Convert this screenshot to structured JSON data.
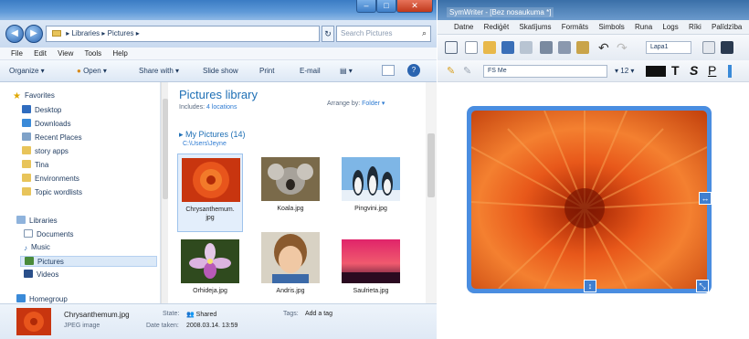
{
  "explorer": {
    "window_buttons": {
      "min": "–",
      "max": "□",
      "close": "✕"
    },
    "address": {
      "path": "▸ Libraries ▸ Pictures ▸",
      "refresh": "↻"
    },
    "search_placeholder": "Search Pictures",
    "menu": [
      "File",
      "Edit",
      "View",
      "Tools",
      "Help"
    ],
    "commands": {
      "organize": "Organize ▾",
      "open": "Open ▾",
      "share": "Share with ▾",
      "slideshow": "Slide show",
      "print": "Print",
      "email": "E-mail",
      "burn": "▾",
      "views": "▾"
    },
    "nav": {
      "favorites": "Favorites",
      "desktop": "Desktop",
      "downloads": "Downloads",
      "recent": "Recent Places",
      "story_apps": "story apps",
      "tina": "Tina",
      "environments": "Environments",
      "topic": "Topic wordlists",
      "libraries": "Libraries",
      "documents": "Documents",
      "music": "Music",
      "pictures": "Pictures",
      "videos": "Videos",
      "homegroup": "Homegroup"
    },
    "library": {
      "title": "Pictures library",
      "includes_label": "Includes:",
      "includes_value": "4 locations",
      "arrange_label": "Arrange by:",
      "arrange_value": "Folder ▾"
    },
    "group": {
      "title": "▸ My Pictures (14)",
      "path": "C:\\Users\\Jeyne"
    },
    "files": [
      {
        "name": "Chrysanthemum.",
        "name2": "jpg"
      },
      {
        "name": "Koala.jpg",
        "name2": ""
      },
      {
        "name": "Pingvini.jpg",
        "name2": ""
      },
      {
        "name": "Orhideja.jpg",
        "name2": ""
      },
      {
        "name": "Andris.jpg",
        "name2": ""
      },
      {
        "name": "Saulrieta.jpg",
        "name2": ""
      }
    ],
    "details": {
      "filename": "Chrysanthemum.jpg",
      "filetype": "JPEG image",
      "state_label": "State:",
      "state_value": "Shared",
      "date_label": "Date taken:",
      "date_value": "2008.03.14. 13:59",
      "tags_label": "Tags:",
      "tags_value": "Add a tag"
    }
  },
  "writer": {
    "title": "SymWriter - [Bez nosaukuma *]",
    "menu": [
      "Datne",
      "Rediģēt",
      "Skatījums",
      "Formāts",
      "Simbols",
      "Runa",
      "Logs",
      "Rīki",
      "Palīdzība"
    ],
    "page_label": "Lapa1",
    "font_name": "FS Me",
    "font_size": "▾ 12 ▾",
    "text_buttons": {
      "t": "T",
      "s": "S",
      "p": "P"
    }
  },
  "colors": {
    "accent": "#1e6fb5",
    "link": "#2e7bd2",
    "writer_frame": "#4a8de0"
  }
}
